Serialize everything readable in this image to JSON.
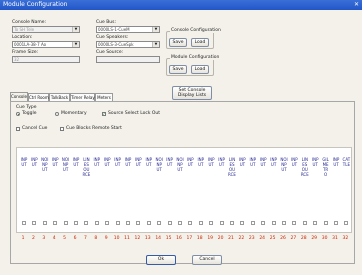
{
  "window": {
    "title": "Module Configuration"
  },
  "console_name": {
    "label": "Console Name:",
    "value": "To SH Tele"
  },
  "cue_bus": {
    "label": "Cue Bus:",
    "value": "0000LS-1-CueM"
  },
  "location": {
    "label": "Location:",
    "value": "0001LA-38-7 Ao"
  },
  "cue_speakers": {
    "label": "Cue Speakers:",
    "value": "0000LS-3-CueSpk"
  },
  "frame_size": {
    "label": "Frame Size:",
    "value": "32"
  },
  "cue_source": {
    "label": "Cue Source:",
    "value": ""
  },
  "console_configuration": {
    "title": "Console Configuration",
    "save": "Save",
    "load": "Load"
  },
  "module_configuration": {
    "title": "Module Configuration",
    "save": "Save",
    "load": "Load"
  },
  "set_console_display_lists": "Set Console Display Lists",
  "tabs": [
    "Console",
    "Ctrl Room",
    "TalkBack",
    "Timer Relays",
    "Meters"
  ],
  "cue_type": {
    "label": "Cue Type",
    "options": [
      "Toggle",
      "Momentary"
    ],
    "selected": "Toggle",
    "source_select_lock_out": "Source Select Lock Out"
  },
  "checkboxes": {
    "cancel_cue": "Cancel Cue",
    "cue_blocks_remote_start": "Cue Blocks Remote Start"
  },
  "channels": [
    {
      "num": "1",
      "name": "INPUT"
    },
    {
      "num": "2",
      "name": "INPUT"
    },
    {
      "num": "3",
      "name": "NOINPUT"
    },
    {
      "num": "4",
      "name": "INPUT"
    },
    {
      "num": "5",
      "name": "NOINPUT"
    },
    {
      "num": "6",
      "name": "INPUT"
    },
    {
      "num": "7",
      "name": "LINESOURCE"
    },
    {
      "num": "8",
      "name": "INPUT"
    },
    {
      "num": "9",
      "name": "INPUT"
    },
    {
      "num": "10",
      "name": "INPUT"
    },
    {
      "num": "11",
      "name": "INPUT"
    },
    {
      "num": "12",
      "name": "INPUT"
    },
    {
      "num": "13",
      "name": "INPUT"
    },
    {
      "num": "14",
      "name": "NOINPUT"
    },
    {
      "num": "15",
      "name": "INPUT"
    },
    {
      "num": "16",
      "name": "NOINPUT"
    },
    {
      "num": "17",
      "name": "INPUT"
    },
    {
      "num": "18",
      "name": "INPUT"
    },
    {
      "num": "19",
      "name": "INPUT"
    },
    {
      "num": "20",
      "name": "INPUT"
    },
    {
      "num": "21",
      "name": "LINESOURCE"
    },
    {
      "num": "22",
      "name": "INPUT"
    },
    {
      "num": "23",
      "name": "INPUT"
    },
    {
      "num": "24",
      "name": "INPUT"
    },
    {
      "num": "25",
      "name": "INPUT"
    },
    {
      "num": "26",
      "name": "NOINPUT"
    },
    {
      "num": "27",
      "name": "INPUT"
    },
    {
      "num": "28",
      "name": "LINESOURCE"
    },
    {
      "num": "29",
      "name": "INPUT"
    },
    {
      "num": "30",
      "name": "GILMETRO"
    },
    {
      "num": "31",
      "name": "INPUT"
    },
    {
      "num": "32",
      "name": "CATTLE"
    }
  ],
  "buttons": {
    "ok": "Ok",
    "cancel": "Cancel"
  }
}
